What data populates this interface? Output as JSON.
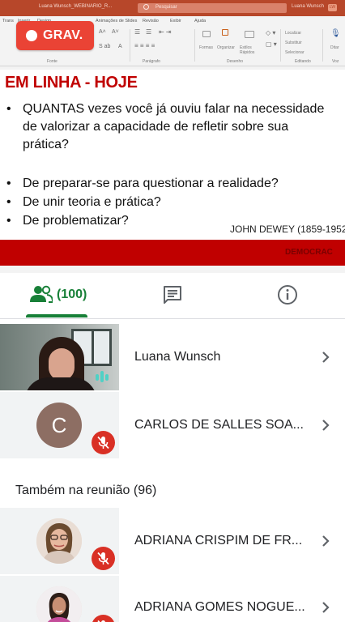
{
  "shared_screen": {
    "app_title": "Luana Wunsch_WEBINARIO_R...",
    "search_placeholder": "Pesquisar",
    "user_name": "Luana Wunsch",
    "user_initials": "LW",
    "menu_items": [
      "Trans",
      "Inserir",
      "Design",
      "Animações de Slides",
      "Revisão",
      "Exibir",
      "Ajuda"
    ],
    "ribbon_groups": [
      "Fonte",
      "Parágrafo",
      "Desenho",
      "Editando",
      "Voz"
    ],
    "ribbon_buttons": [
      "Formas",
      "Organizar",
      "Estilos Rápidos",
      "Localizar",
      "Substituir",
      "Selecionar",
      "Ditar"
    ],
    "slide": {
      "title": "EM LINHA - HOJE",
      "bullets": [
        "QUANTAS vezes você já ouviu falar na necessidade de valorizar a capacidade de refletir sobre sua prática?",
        "De preparar-se para questionar a realidade?",
        "De unir teoria e prática?",
        "De problematizar?"
      ],
      "author": "JOHN DEWEY (1859-1952",
      "footer_text": "DEMOCRAC"
    },
    "accent_color": "#b7472a",
    "slide_red": "#c00000"
  },
  "recording": {
    "label": "GRAV.",
    "color": "#ea4335"
  },
  "tabs": {
    "people_count": "(100)",
    "active_tab": "people",
    "accent_color": "#188038"
  },
  "participants": [
    {
      "name": "Luana Wunsch",
      "tile": "video",
      "muted": false
    },
    {
      "name": "CARLOS DE SALLES SOA...",
      "tile": "initial",
      "initial": "C",
      "avatar_color": "#8d6e63",
      "muted": true
    }
  ],
  "also_in_meeting": {
    "title": "Também na reunião (96)",
    "participants": [
      {
        "name": "ADRIANA CRISPIM DE FR...",
        "tile": "photo",
        "muted": true
      },
      {
        "name": "ADRIANA GOMES NOGUE...",
        "tile": "photo",
        "muted": true
      }
    ]
  },
  "icons": {
    "people": "people-icon",
    "chat": "chat-icon",
    "info": "info-icon",
    "mic_off": "mic-off-icon",
    "chevron": "chevron-right-icon"
  },
  "mute_color": "#d93025"
}
